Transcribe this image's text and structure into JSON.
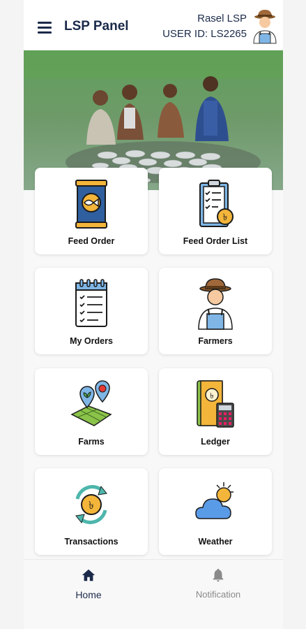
{
  "header": {
    "title": "LSP Panel",
    "user_name": "Rasel LSP",
    "user_id": "USER ID: LS2265"
  },
  "menu": [
    {
      "label": "Feed Order",
      "icon": "feed-bag-icon"
    },
    {
      "label": "Feed Order List",
      "icon": "clipboard-list-icon"
    },
    {
      "label": "My Orders",
      "icon": "notepad-checklist-icon"
    },
    {
      "label": "Farmers",
      "icon": "farmer-icon"
    },
    {
      "label": "Farms",
      "icon": "map-pins-icon"
    },
    {
      "label": "Ledger",
      "icon": "ledger-calculator-icon"
    },
    {
      "label": "Transactions",
      "icon": "taka-exchange-icon"
    },
    {
      "label": "Weather",
      "icon": "sun-cloud-icon"
    }
  ],
  "bottom_nav": {
    "home": {
      "label": "Home",
      "icon": "home-icon"
    },
    "notification": {
      "label": "Notification",
      "icon": "bell-icon"
    }
  },
  "colors": {
    "primary": "#1b2a4a",
    "inactive": "#8a8a8a"
  }
}
